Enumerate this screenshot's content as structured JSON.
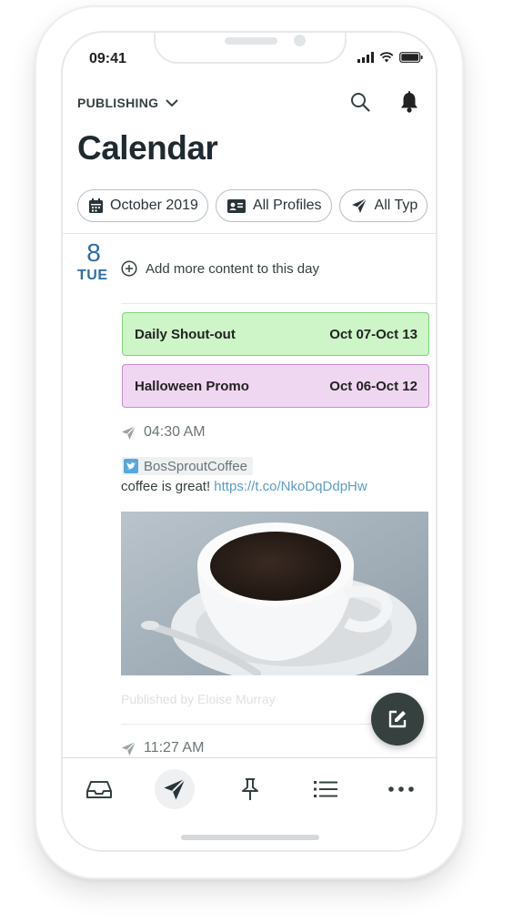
{
  "status": {
    "time": "09:41"
  },
  "header": {
    "section_label": "PUBLISHING",
    "title": "Calendar",
    "icons": [
      "search-icon",
      "bell-icon"
    ]
  },
  "filters": [
    {
      "icon": "calendar-icon",
      "label": "October 2019"
    },
    {
      "icon": "profile-card-icon",
      "label": "All Profiles"
    },
    {
      "icon": "send-icon",
      "label": "All Typ"
    }
  ],
  "day": {
    "number": "8",
    "weekday": "TUE",
    "add_more_label": "Add more content to this day"
  },
  "campaigns": [
    {
      "name": "Daily Shout-out",
      "range": "Oct 07-Oct 13",
      "color": "#cdf5c7"
    },
    {
      "name": "Halloween Promo",
      "range": "Oct 06-Oct 12",
      "color": "#f0d7f1"
    }
  ],
  "posts": [
    {
      "time": "04:30 AM",
      "profile": "BosSproutCoffee",
      "text": "coffee is great!",
      "link": "https://t.co/NkoDqDdpHw",
      "published_by": "Published by Eloise Murray"
    },
    {
      "time": "11:27 AM"
    }
  ],
  "tabbar": {
    "items": [
      "inbox-icon",
      "send-icon",
      "pin-icon",
      "list-icon",
      "more-icon"
    ],
    "active": "send-icon"
  },
  "colors": {
    "accent": "#2d6ea6",
    "fab": "#35403f",
    "link": "#5b9cc8"
  }
}
